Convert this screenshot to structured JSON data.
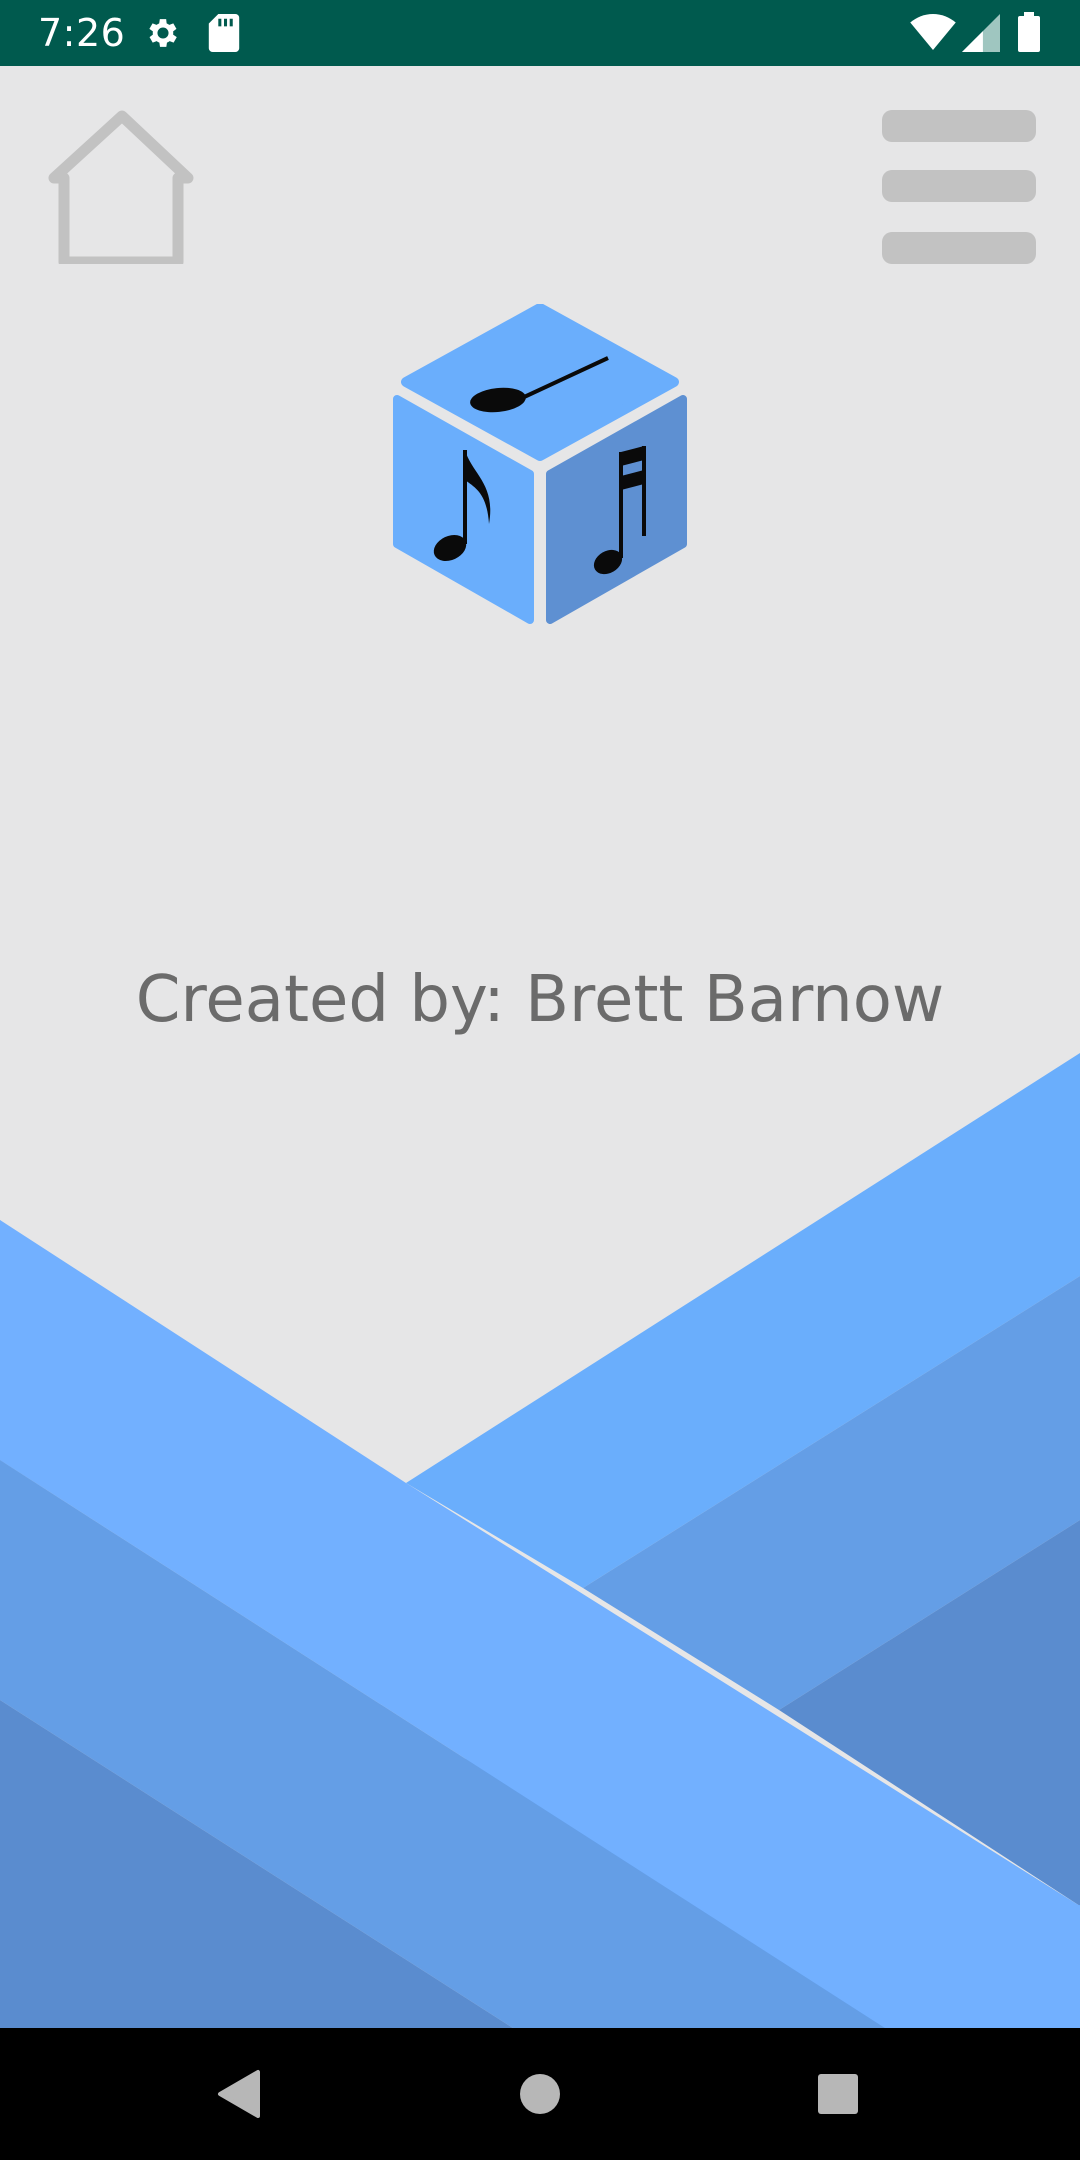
{
  "status_bar": {
    "time": "7:26",
    "icons": [
      "gear-icon",
      "sd-card-icon",
      "wifi-icon",
      "cell-signal-icon",
      "battery-icon"
    ]
  },
  "header": {
    "home_icon": "home-icon",
    "menu_icon": "hamburger-menu-icon"
  },
  "logo": {
    "icon": "music-dice-cube-logo"
  },
  "credit_text": "Created by: Brett Barnow",
  "navigation": {
    "back_icon": "back-triangle-icon",
    "home_icon": "home-circle-icon",
    "recents_icon": "recents-square-icon"
  },
  "colors": {
    "status_bar": "#005a4e",
    "background": "#e6e6e7",
    "cube_light": "#6aaefc",
    "cube_dark": "#5e90d2",
    "band_bright": "#72b0ff",
    "band_light": "#6aacfd",
    "band_mid": "#649ee6",
    "band_dark": "#5a8ccf",
    "credit_text": "#6b6b6b",
    "control_gray": "#c2c2c2"
  }
}
